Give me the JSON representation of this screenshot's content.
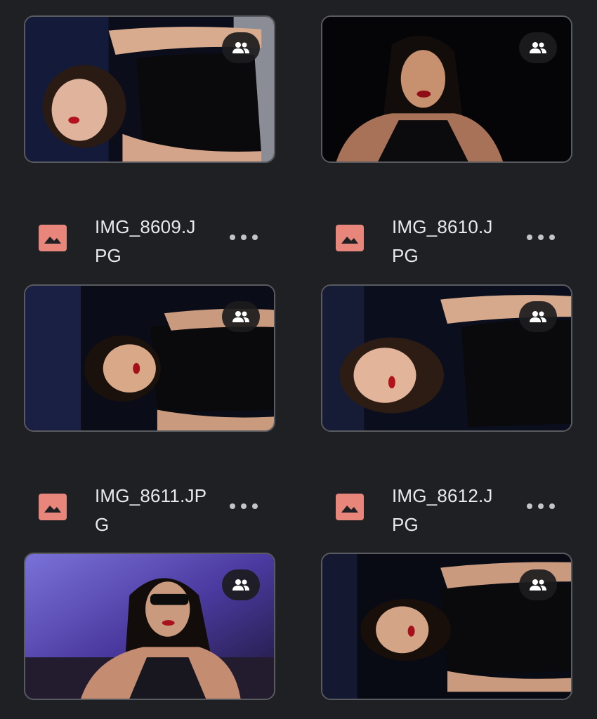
{
  "photos": [
    {
      "label": "photo-thumbnail",
      "shared_icon": "shared-people-icon"
    },
    {
      "label": "photo-thumbnail",
      "shared_icon": "shared-people-icon"
    },
    {
      "label": "photo-thumbnail",
      "shared_icon": "shared-people-icon"
    },
    {
      "label": "photo-thumbnail",
      "shared_icon": "shared-people-icon"
    },
    {
      "label": "photo-thumbnail",
      "shared_icon": "shared-people-icon"
    },
    {
      "label": "photo-thumbnail",
      "shared_icon": "shared-people-icon"
    }
  ],
  "files": [
    {
      "name": "IMG_8609.JPG",
      "icon": "image-file-icon",
      "menu_icon": "more-options-icon"
    },
    {
      "name": "IMG_8610.JPG",
      "icon": "image-file-icon",
      "menu_icon": "more-options-icon"
    },
    {
      "name": "IMG_8611.JPG",
      "icon": "image-file-icon",
      "menu_icon": "more-options-icon"
    },
    {
      "name": "IMG_8612.JPG",
      "icon": "image-file-icon",
      "menu_icon": "more-options-icon"
    }
  ],
  "colors": {
    "background": "#1f2023",
    "file_icon": "#e8867c",
    "text": "#e9e9eb",
    "badge_bg": "#1c1c1e"
  }
}
